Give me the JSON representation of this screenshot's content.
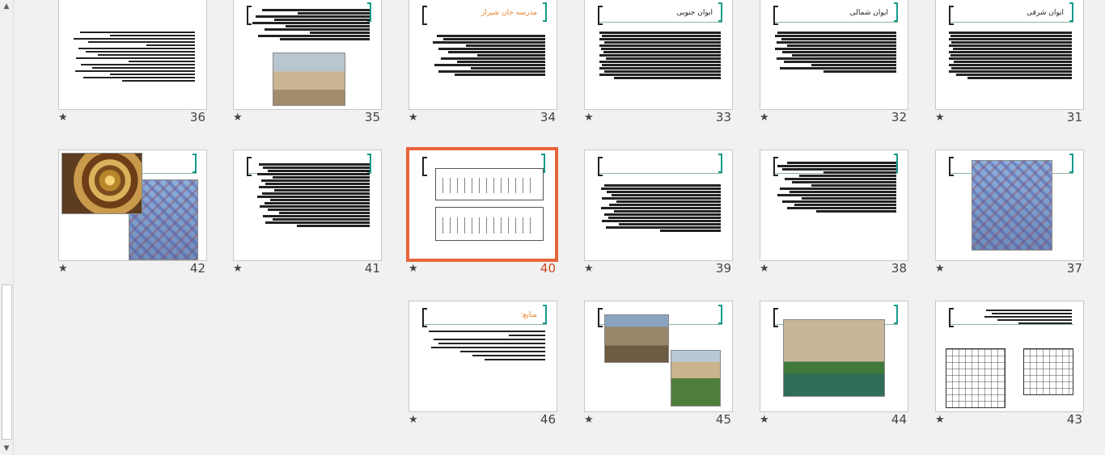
{
  "slides": [
    {
      "number": "36",
      "title": "",
      "title_orange": false
    },
    {
      "number": "35",
      "title": "",
      "title_orange": false
    },
    {
      "number": "34",
      "title": "مدرسه خان شیراز",
      "title_orange": true
    },
    {
      "number": "33",
      "title": "ایوان جنوبی",
      "title_orange": false
    },
    {
      "number": "32",
      "title": "ایوان شمالی",
      "title_orange": false
    },
    {
      "number": "31",
      "title": "ایوان شرقی",
      "title_orange": false
    },
    {
      "number": "42",
      "title": "",
      "title_orange": false
    },
    {
      "number": "41",
      "title": "",
      "title_orange": false
    },
    {
      "number": "40",
      "title": "",
      "title_orange": false,
      "selected": true
    },
    {
      "number": "39",
      "title": "",
      "title_orange": false
    },
    {
      "number": "38",
      "title": "",
      "title_orange": false
    },
    {
      "number": "37",
      "title": "",
      "title_orange": false
    },
    {
      "number": "46",
      "title": "منابع:",
      "title_orange": true
    },
    {
      "number": "45",
      "title": "",
      "title_orange": false
    },
    {
      "number": "44",
      "title": "",
      "title_orange": false
    },
    {
      "number": "43",
      "title": "",
      "title_orange": false
    }
  ],
  "star_glyph": "★",
  "scrollbar": {
    "up_icon": "▲",
    "down_icon": "▼"
  },
  "colors": {
    "selection": "#e8643c",
    "accent_bracket": "#159a8c",
    "title_orange": "#e8842c"
  }
}
